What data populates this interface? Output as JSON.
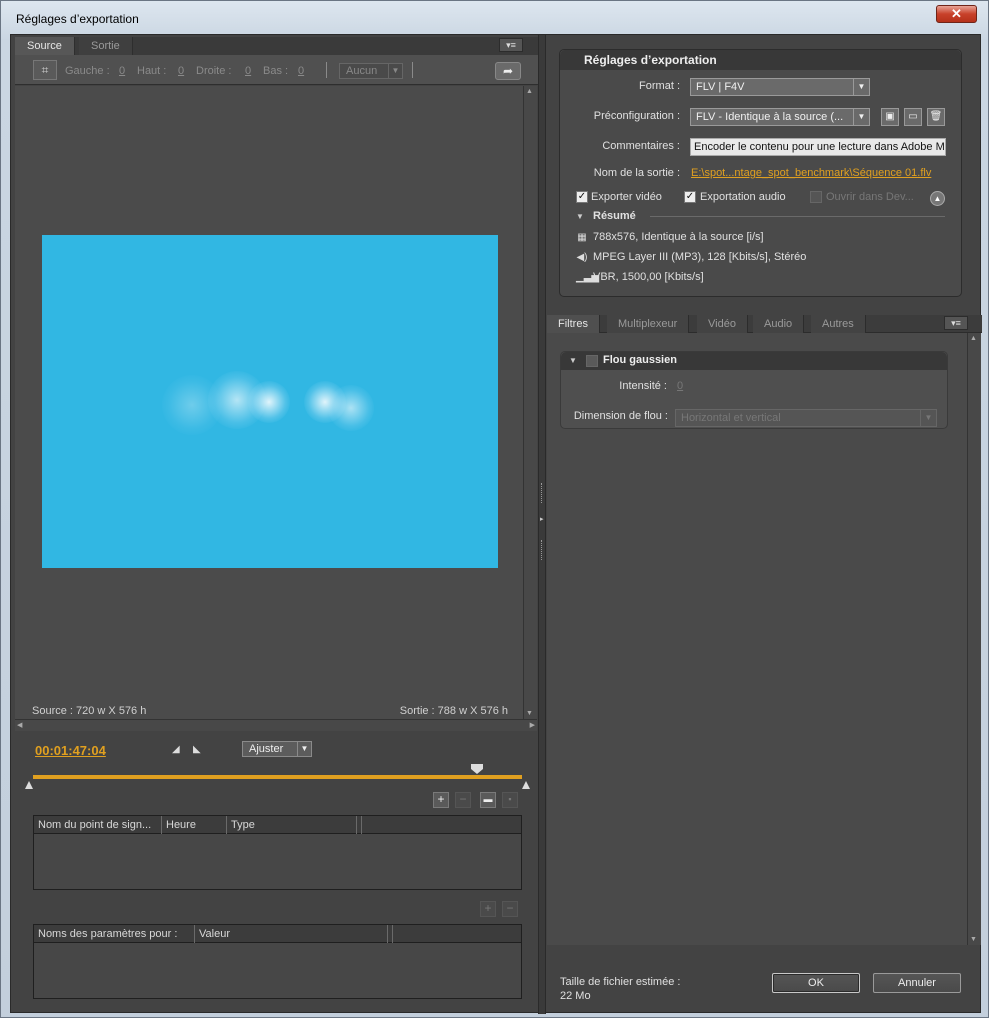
{
  "window": {
    "title": "Réglages d’exportation",
    "close_glyph": "✕"
  },
  "left": {
    "tabs": [
      {
        "label": "Source"
      },
      {
        "label": "Sortie"
      }
    ],
    "panel_menu_icon": "panel-menu-icon",
    "crop": {
      "gauche_label": "Gauche :",
      "gauche_value": "0",
      "haut_label": "Haut :",
      "haut_value": "0",
      "droite_label": "Droite :",
      "droite_value": "0",
      "bas_label": "Bas :",
      "bas_value": "0",
      "ratio_value": "Aucun"
    },
    "preview": {
      "color": "#31b7e3"
    },
    "source_size": "Source : 720 w X 576 h",
    "output_size": "Sortie : 788 w X 576 h",
    "timeline": {
      "timecode": "00:01:47:04",
      "fit_value": "Ajuster",
      "accent_color": "#e0a020"
    },
    "cue_table": {
      "columns": [
        "Nom du point de sign...",
        "Heure",
        "Type",
        ""
      ],
      "rows": []
    },
    "params_table": {
      "columns": [
        "Noms des paramètres pour :",
        "Valeur",
        ""
      ],
      "rows": []
    }
  },
  "right": {
    "export_settings_title": "Réglages d’exportation",
    "format_label": "Format :",
    "format_value": "FLV | F4V",
    "preset_label": "Préconfiguration :",
    "preset_value": "FLV - Identique à la source (...",
    "comments_label": "Commentaires :",
    "comments_value": "Encoder le contenu pour une lecture dans Adobe Me",
    "output_label": "Nom de la sortie :",
    "output_value": "E:\\spot...ntage_spot_benchmark\\Séquence 01.flv",
    "export_video": {
      "label": "Exporter vidéo",
      "checked": true
    },
    "export_audio": {
      "label": "Exportation audio",
      "checked": true
    },
    "open_in_dev": {
      "label": "Ouvrir dans Dev...",
      "checked": false
    },
    "summary_title": "Résumé",
    "summary": [
      {
        "icon": "film-icon",
        "text": "788x576, Identique à la source [i/s]"
      },
      {
        "icon": "speaker-icon",
        "text": "MPEG Layer III (MP3), 128 [Kbits/s], Stéréo"
      },
      {
        "icon": "bitrate-icon",
        "text": "VBR, 1500,00 [Kbits/s]"
      }
    ],
    "tabs": [
      {
        "label": "Filtres"
      },
      {
        "label": "Multiplexeur"
      },
      {
        "label": "Vidéo"
      },
      {
        "label": "Audio"
      },
      {
        "label": "Autres"
      }
    ],
    "filter": {
      "name": "Flou gaussien",
      "intensity_label": "Intensité :",
      "intensity_value": "0",
      "blur_dim_label": "Dimension de flou :",
      "blur_dim_value": "Horizontal et vertical"
    },
    "file_size_label": "Taille de fichier estimée :",
    "file_size_value": "22 Mo",
    "ok_label": "OK",
    "cancel_label": "Annuler"
  }
}
